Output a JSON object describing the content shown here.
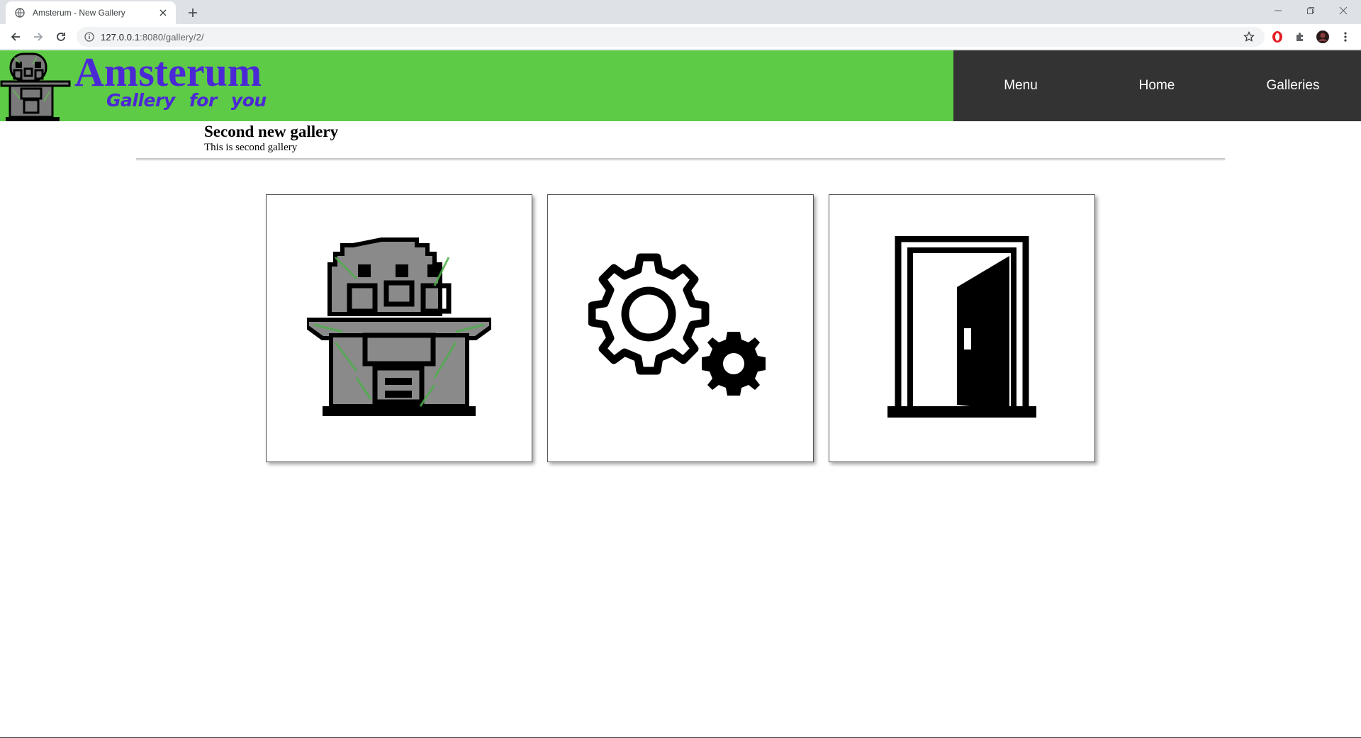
{
  "browser": {
    "tab_title": "Amsterum - New Gallery",
    "url_host": "127.0.0.1",
    "url_path": ":8080/gallery/2/"
  },
  "site": {
    "brand_name": "Amsterum",
    "tagline": "Gallery for you",
    "colors": {
      "header_green": "#5ecb47",
      "brand_purple": "#4b28d6",
      "nav_dark": "#333333"
    },
    "nav": [
      {
        "label": "Menu"
      },
      {
        "label": "Home"
      },
      {
        "label": "Galleries"
      }
    ]
  },
  "gallery": {
    "title": "Second new gallery",
    "description": "This is second gallery",
    "items": [
      {
        "icon": "robot-figure-icon"
      },
      {
        "icon": "gears-icon"
      },
      {
        "icon": "open-door-icon"
      }
    ]
  }
}
